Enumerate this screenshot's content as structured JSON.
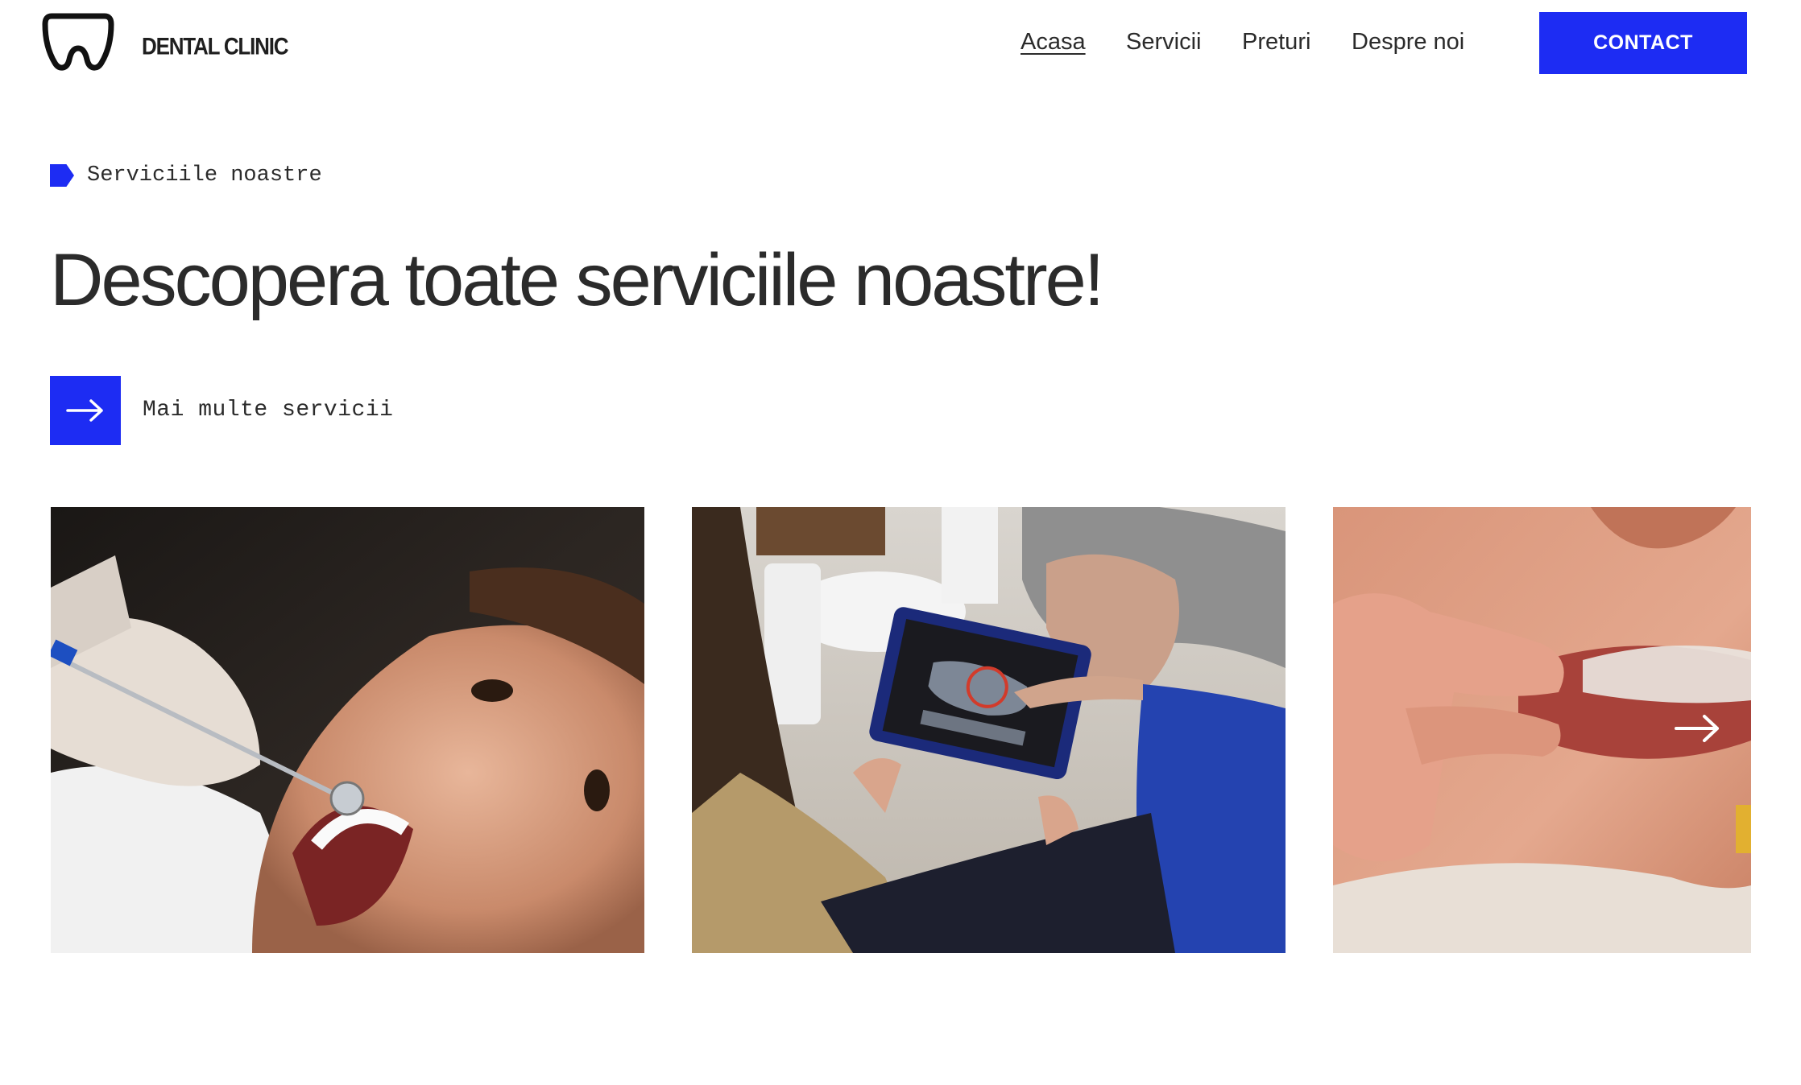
{
  "header": {
    "brand": "DENTAL CLINIC",
    "logo_icon": "tooth-logo-icon",
    "nav": [
      {
        "label": "Acasa",
        "active": true
      },
      {
        "label": "Servicii",
        "active": false
      },
      {
        "label": "Preturi",
        "active": false
      },
      {
        "label": "Despre noi",
        "active": false
      }
    ],
    "contact_label": "CONTACT"
  },
  "hero": {
    "eyebrow": "Serviciile noastre",
    "heading": "Descopera toate serviciile noastre!",
    "more_label": "Mai multe servicii",
    "more_icon": "arrow-right-icon"
  },
  "gallery": {
    "cards": [
      {
        "subject": "patient-dental-checkup-photo"
      },
      {
        "subject": "dentist-tablet-xray-photo"
      },
      {
        "subject": "clear-aligner-photo"
      }
    ],
    "next_icon": "arrow-right-icon"
  },
  "colors": {
    "accent": "#1d2cf3",
    "text": "#2b2b2b",
    "background": "#ffffff"
  }
}
